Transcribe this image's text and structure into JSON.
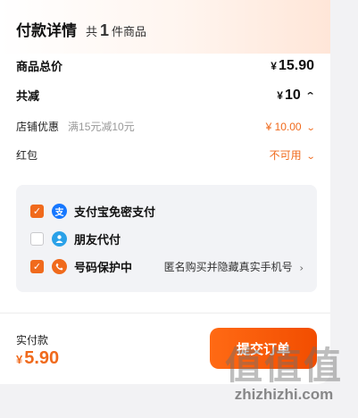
{
  "header": {
    "title": "付款详情",
    "count_prefix": "共",
    "count": "1",
    "count_suffix": "件商品"
  },
  "summary": {
    "subtotal_label": "商品总价",
    "subtotal_currency": "¥",
    "subtotal_value": "15.90",
    "discount_label": "共减",
    "discount_currency": "¥",
    "discount_value": "10",
    "shop_coupon_label": "店铺优惠",
    "shop_coupon_desc": "满15元减10元",
    "shop_coupon_value": "¥ 10.00",
    "red_packet_label": "红包",
    "red_packet_value": "不可用"
  },
  "payment_options": [
    {
      "name": "支付宝免密支付",
      "checked": true,
      "icon": "alipay-icon",
      "extra": ""
    },
    {
      "name": "朋友代付",
      "checked": false,
      "icon": "friend-pay-icon",
      "extra": ""
    },
    {
      "name": "号码保护中",
      "checked": true,
      "icon": "shield-phone-icon",
      "extra": "匿名购买并隐藏真实手机号"
    }
  ],
  "footer": {
    "total_label": "实付款",
    "total_currency": "¥",
    "total_value": "5.90",
    "submit_label": "提交订单"
  },
  "watermark": {
    "logo": "值值值",
    "url": "zhizhizhi.com"
  },
  "colors": {
    "accent": "#f06a1c",
    "alipay": "#1677ff",
    "friend": "#2aa1e8",
    "shield": "#f06a1c"
  }
}
